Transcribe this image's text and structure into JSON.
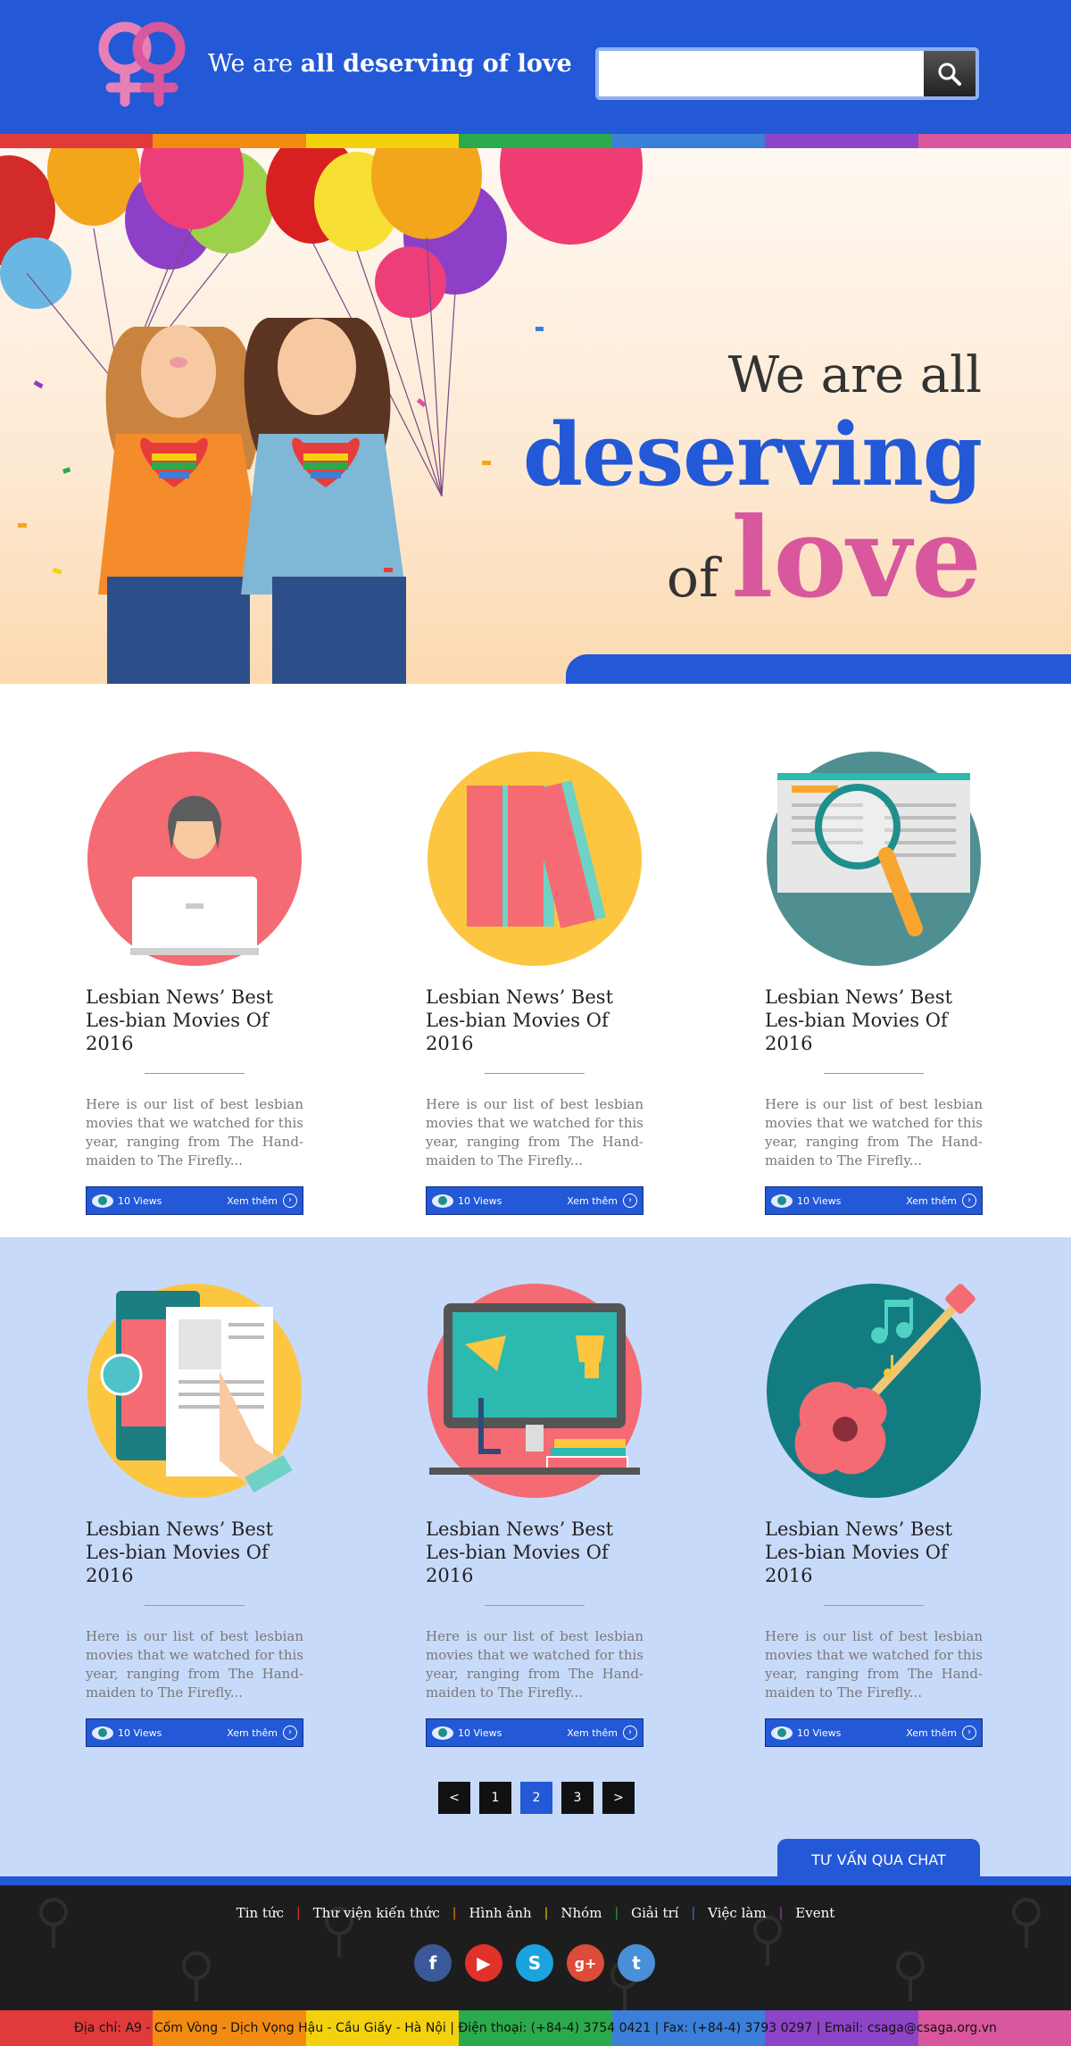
{
  "header": {
    "tagline_part1": "We are ",
    "tagline_part2": "all deserving of love",
    "search_placeholder": "",
    "search_icon": "magnifier-icon",
    "logo_icon": "female-symbols-logo",
    "rainbow_colors": [
      "#e03a3a",
      "#f28b12",
      "#f4d10f",
      "#2aaa4c",
      "#3b7fd9",
      "#8e44c6",
      "#d9579d"
    ]
  },
  "hero": {
    "line1": "We are all",
    "line2": "deserving",
    "line3_of": "of",
    "line3_love": "love"
  },
  "cards": [
    {
      "icon": "woman-laptop-icon",
      "title": "Lesbian News’ Best Les-bian Movies Of 2016",
      "desc": "Here is our list of best lesbian movies that we watched for this year, ranging from The Hand-maiden to The Firefly...",
      "views": "10 Views",
      "more": "Xem thêm"
    },
    {
      "icon": "books-icon",
      "title": "Lesbian News’ Best Les-bian Movies Of 2016",
      "desc": "Here is our list of best lesbian movies that we watched for this year, ranging from The Hand-maiden to The Firefly...",
      "views": "10 Views",
      "more": "Xem thêm"
    },
    {
      "icon": "book-magnifier-icon",
      "title": "Lesbian News’ Best Les-bian Movies Of 2016",
      "desc": "Here is our list of best lesbian movies that we watched for this year, ranging from The Hand-maiden to The Firefly...",
      "views": "10 Views",
      "more": "Xem thêm"
    },
    {
      "icon": "tablet-touch-icon",
      "title": "Lesbian News’ Best Les-bian Movies Of 2016",
      "desc": "Here is our list of best lesbian movies that we watched for this year, ranging from The Hand-maiden to The Firefly...",
      "views": "10 Views",
      "more": "Xem thêm"
    },
    {
      "icon": "desk-trophy-icon",
      "title": "Lesbian News’ Best Les-bian Movies Of 2016",
      "desc": "Here is our list of best lesbian movies that we watched for this year, ranging from The Hand-maiden to The Firefly...",
      "views": "10 Views",
      "more": "Xem thêm"
    },
    {
      "icon": "guitar-icon",
      "title": "Lesbian News’ Best Les-bian Movies Of 2016",
      "desc": "Here is our list of best lesbian movies that we watched for this year, ranging from The Hand-maiden to The Firefly...",
      "views": "10 Views",
      "more": "Xem thêm"
    }
  ],
  "pagination": {
    "prev": "<",
    "pages": [
      "1",
      "2",
      "3"
    ],
    "current": "2",
    "next": ">"
  },
  "chat_button": "TƯ VẤN QUA CHAT",
  "footer": {
    "nav": [
      "Tin tức",
      "Thư viện kiến thức",
      "Hình ảnh",
      "Nhóm",
      "Giải trí",
      "Việc làm",
      "Event"
    ],
    "nav_separator_colors": [
      "#e03a3a",
      "#f28b12",
      "#f4d10f",
      "#2aaa4c",
      "#3b7fd9",
      "#8e44c6"
    ],
    "socials": [
      {
        "icon": "facebook-icon",
        "glyph": "f",
        "color": "#3b5998"
      },
      {
        "icon": "youtube-icon",
        "glyph": "▶",
        "color": "#e0322b"
      },
      {
        "icon": "skype-icon",
        "glyph": "S",
        "color": "#1aa3de"
      },
      {
        "icon": "google-plus-icon",
        "glyph": "g+",
        "color": "#dd4b39"
      },
      {
        "icon": "twitter-icon",
        "glyph": "t",
        "color": "#4a90d9"
      }
    ],
    "address": "Địa chỉ: A9 - Cốm Vòng - Dịch Vọng Hậu - Cầu Giấy - Hà Nội | Điện thoại: (+84-4) 3754 0421 | Fax: (+84-4) 3793 0297 | Email: csaga@csaga.org.vn"
  }
}
